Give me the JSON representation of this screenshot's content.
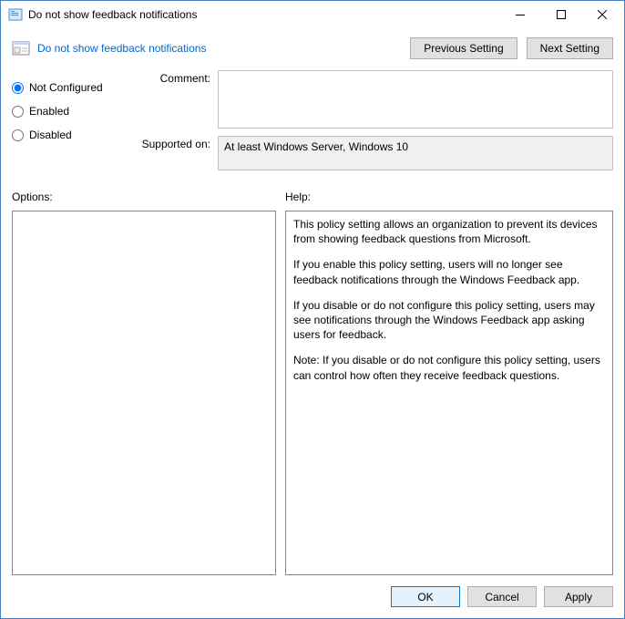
{
  "window": {
    "title": "Do not show feedback notifications"
  },
  "header": {
    "title": "Do not show feedback notifications",
    "previous": "Previous Setting",
    "next": "Next Setting"
  },
  "radios": {
    "not_configured": "Not Configured",
    "enabled": "Enabled",
    "disabled": "Disabled"
  },
  "fields": {
    "comment_label": "Comment:",
    "comment_value": "",
    "supported_label": "Supported on:",
    "supported_value": "At least Windows Server, Windows 10"
  },
  "labels": {
    "options": "Options:",
    "help": "Help:"
  },
  "help": {
    "p1": "This policy setting allows an organization to prevent its devices from showing feedback questions from Microsoft.",
    "p2": "If you enable this policy setting, users will no longer see feedback notifications through the Windows Feedback app.",
    "p3": "If you disable or do not configure this policy setting, users may see notifications through the Windows Feedback app asking users for feedback.",
    "p4": "Note: If you disable or do not configure this policy setting, users can control how often they receive feedback questions."
  },
  "footer": {
    "ok": "OK",
    "cancel": "Cancel",
    "apply": "Apply"
  }
}
